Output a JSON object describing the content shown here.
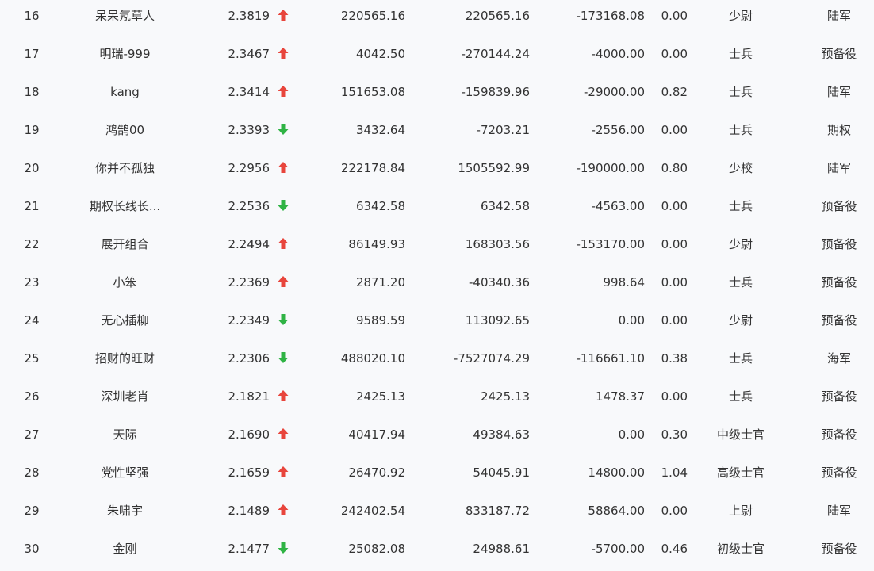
{
  "colors": {
    "up": "#e8453c",
    "down": "#2fb344",
    "text": "#333333",
    "background": "#f8f9fb"
  },
  "rows": [
    {
      "rank": "16",
      "name": "呆呆氖草人",
      "score": "2.3819",
      "trend": "up",
      "v1": "220565.16",
      "v2": "220565.16",
      "v3": "-173168.08",
      "v4": "0.00",
      "military_rank": "少尉",
      "category": "陆军"
    },
    {
      "rank": "17",
      "name": "明瑞-999",
      "score": "2.3467",
      "trend": "up",
      "v1": "4042.50",
      "v2": "-270144.24",
      "v3": "-4000.00",
      "v4": "0.00",
      "military_rank": "士兵",
      "category": "预备役"
    },
    {
      "rank": "18",
      "name": "kang",
      "score": "2.3414",
      "trend": "up",
      "v1": "151653.08",
      "v2": "-159839.96",
      "v3": "-29000.00",
      "v4": "0.82",
      "military_rank": "士兵",
      "category": "陆军"
    },
    {
      "rank": "19",
      "name": "鸿鹄00",
      "score": "2.3393",
      "trend": "down",
      "v1": "3432.64",
      "v2": "-7203.21",
      "v3": "-2556.00",
      "v4": "0.00",
      "military_rank": "士兵",
      "category": "期权"
    },
    {
      "rank": "20",
      "name": "你并不孤独",
      "score": "2.2956",
      "trend": "up",
      "v1": "222178.84",
      "v2": "1505592.99",
      "v3": "-190000.00",
      "v4": "0.80",
      "military_rank": "少校",
      "category": "陆军"
    },
    {
      "rank": "21",
      "name": "期权长线长...",
      "score": "2.2536",
      "trend": "down",
      "v1": "6342.58",
      "v2": "6342.58",
      "v3": "-4563.00",
      "v4": "0.00",
      "military_rank": "士兵",
      "category": "预备役"
    },
    {
      "rank": "22",
      "name": "展开组合",
      "score": "2.2494",
      "trend": "up",
      "v1": "86149.93",
      "v2": "168303.56",
      "v3": "-153170.00",
      "v4": "0.00",
      "military_rank": "少尉",
      "category": "预备役"
    },
    {
      "rank": "23",
      "name": "小笨",
      "score": "2.2369",
      "trend": "up",
      "v1": "2871.20",
      "v2": "-40340.36",
      "v3": "998.64",
      "v4": "0.00",
      "military_rank": "士兵",
      "category": "预备役"
    },
    {
      "rank": "24",
      "name": "无心插柳",
      "score": "2.2349",
      "trend": "down",
      "v1": "9589.59",
      "v2": "113092.65",
      "v3": "0.00",
      "v4": "0.00",
      "military_rank": "少尉",
      "category": "预备役"
    },
    {
      "rank": "25",
      "name": "招财的旺财",
      "score": "2.2306",
      "trend": "down",
      "v1": "488020.10",
      "v2": "-7527074.29",
      "v3": "-116661.10",
      "v4": "0.38",
      "military_rank": "士兵",
      "category": "海军"
    },
    {
      "rank": "26",
      "name": "深圳老肖",
      "score": "2.1821",
      "trend": "up",
      "v1": "2425.13",
      "v2": "2425.13",
      "v3": "1478.37",
      "v4": "0.00",
      "military_rank": "士兵",
      "category": "预备役"
    },
    {
      "rank": "27",
      "name": "天际",
      "score": "2.1690",
      "trend": "up",
      "v1": "40417.94",
      "v2": "49384.63",
      "v3": "0.00",
      "v4": "0.30",
      "military_rank": "中级士官",
      "category": "预备役"
    },
    {
      "rank": "28",
      "name": "党性坚强",
      "score": "2.1659",
      "trend": "up",
      "v1": "26470.92",
      "v2": "54045.91",
      "v3": "14800.00",
      "v4": "1.04",
      "military_rank": "高级士官",
      "category": "预备役"
    },
    {
      "rank": "29",
      "name": "朱啸宇",
      "score": "2.1489",
      "trend": "up",
      "v1": "242402.54",
      "v2": "833187.72",
      "v3": "58864.00",
      "v4": "0.00",
      "military_rank": "上尉",
      "category": "陆军"
    },
    {
      "rank": "30",
      "name": "金刚",
      "score": "2.1477",
      "trend": "down",
      "v1": "25082.08",
      "v2": "24988.61",
      "v3": "-5700.00",
      "v4": "0.46",
      "military_rank": "初级士官",
      "category": "预备役"
    }
  ]
}
